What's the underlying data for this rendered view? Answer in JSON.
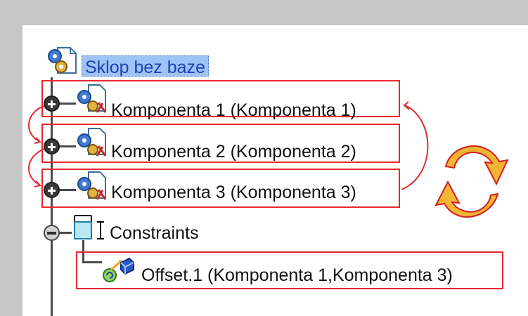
{
  "tree": {
    "root": {
      "label": "Sklop bez baze",
      "icon": "assembly-product-icon"
    },
    "components": [
      {
        "label": "Komponenta 1 (Komponenta 1)",
        "icon": "component-gears-icon",
        "expander": "plus"
      },
      {
        "label": "Komponenta 2 (Komponenta 2)",
        "icon": "component-gears-icon",
        "expander": "plus"
      },
      {
        "label": "Komponenta 3 (Komponenta 3)",
        "icon": "component-gears-icon",
        "expander": "plus"
      }
    ],
    "constraints": {
      "label": "Constraints",
      "icon": "constraints-icon",
      "expander": "minus",
      "children": [
        {
          "label": "Offset.1 (Komponenta 1,Komponenta 3)",
          "icon": "offset-constraint-icon"
        }
      ]
    }
  },
  "colors": {
    "highlight_box": "#e92832",
    "selection_fill": "#9fc3f4",
    "selection_text": "#1a43b5",
    "cycle_arrow_fill": "#f4b434",
    "cycle_arrow_outline": "#d11f1f",
    "frame_background": "#c7c7c7"
  }
}
